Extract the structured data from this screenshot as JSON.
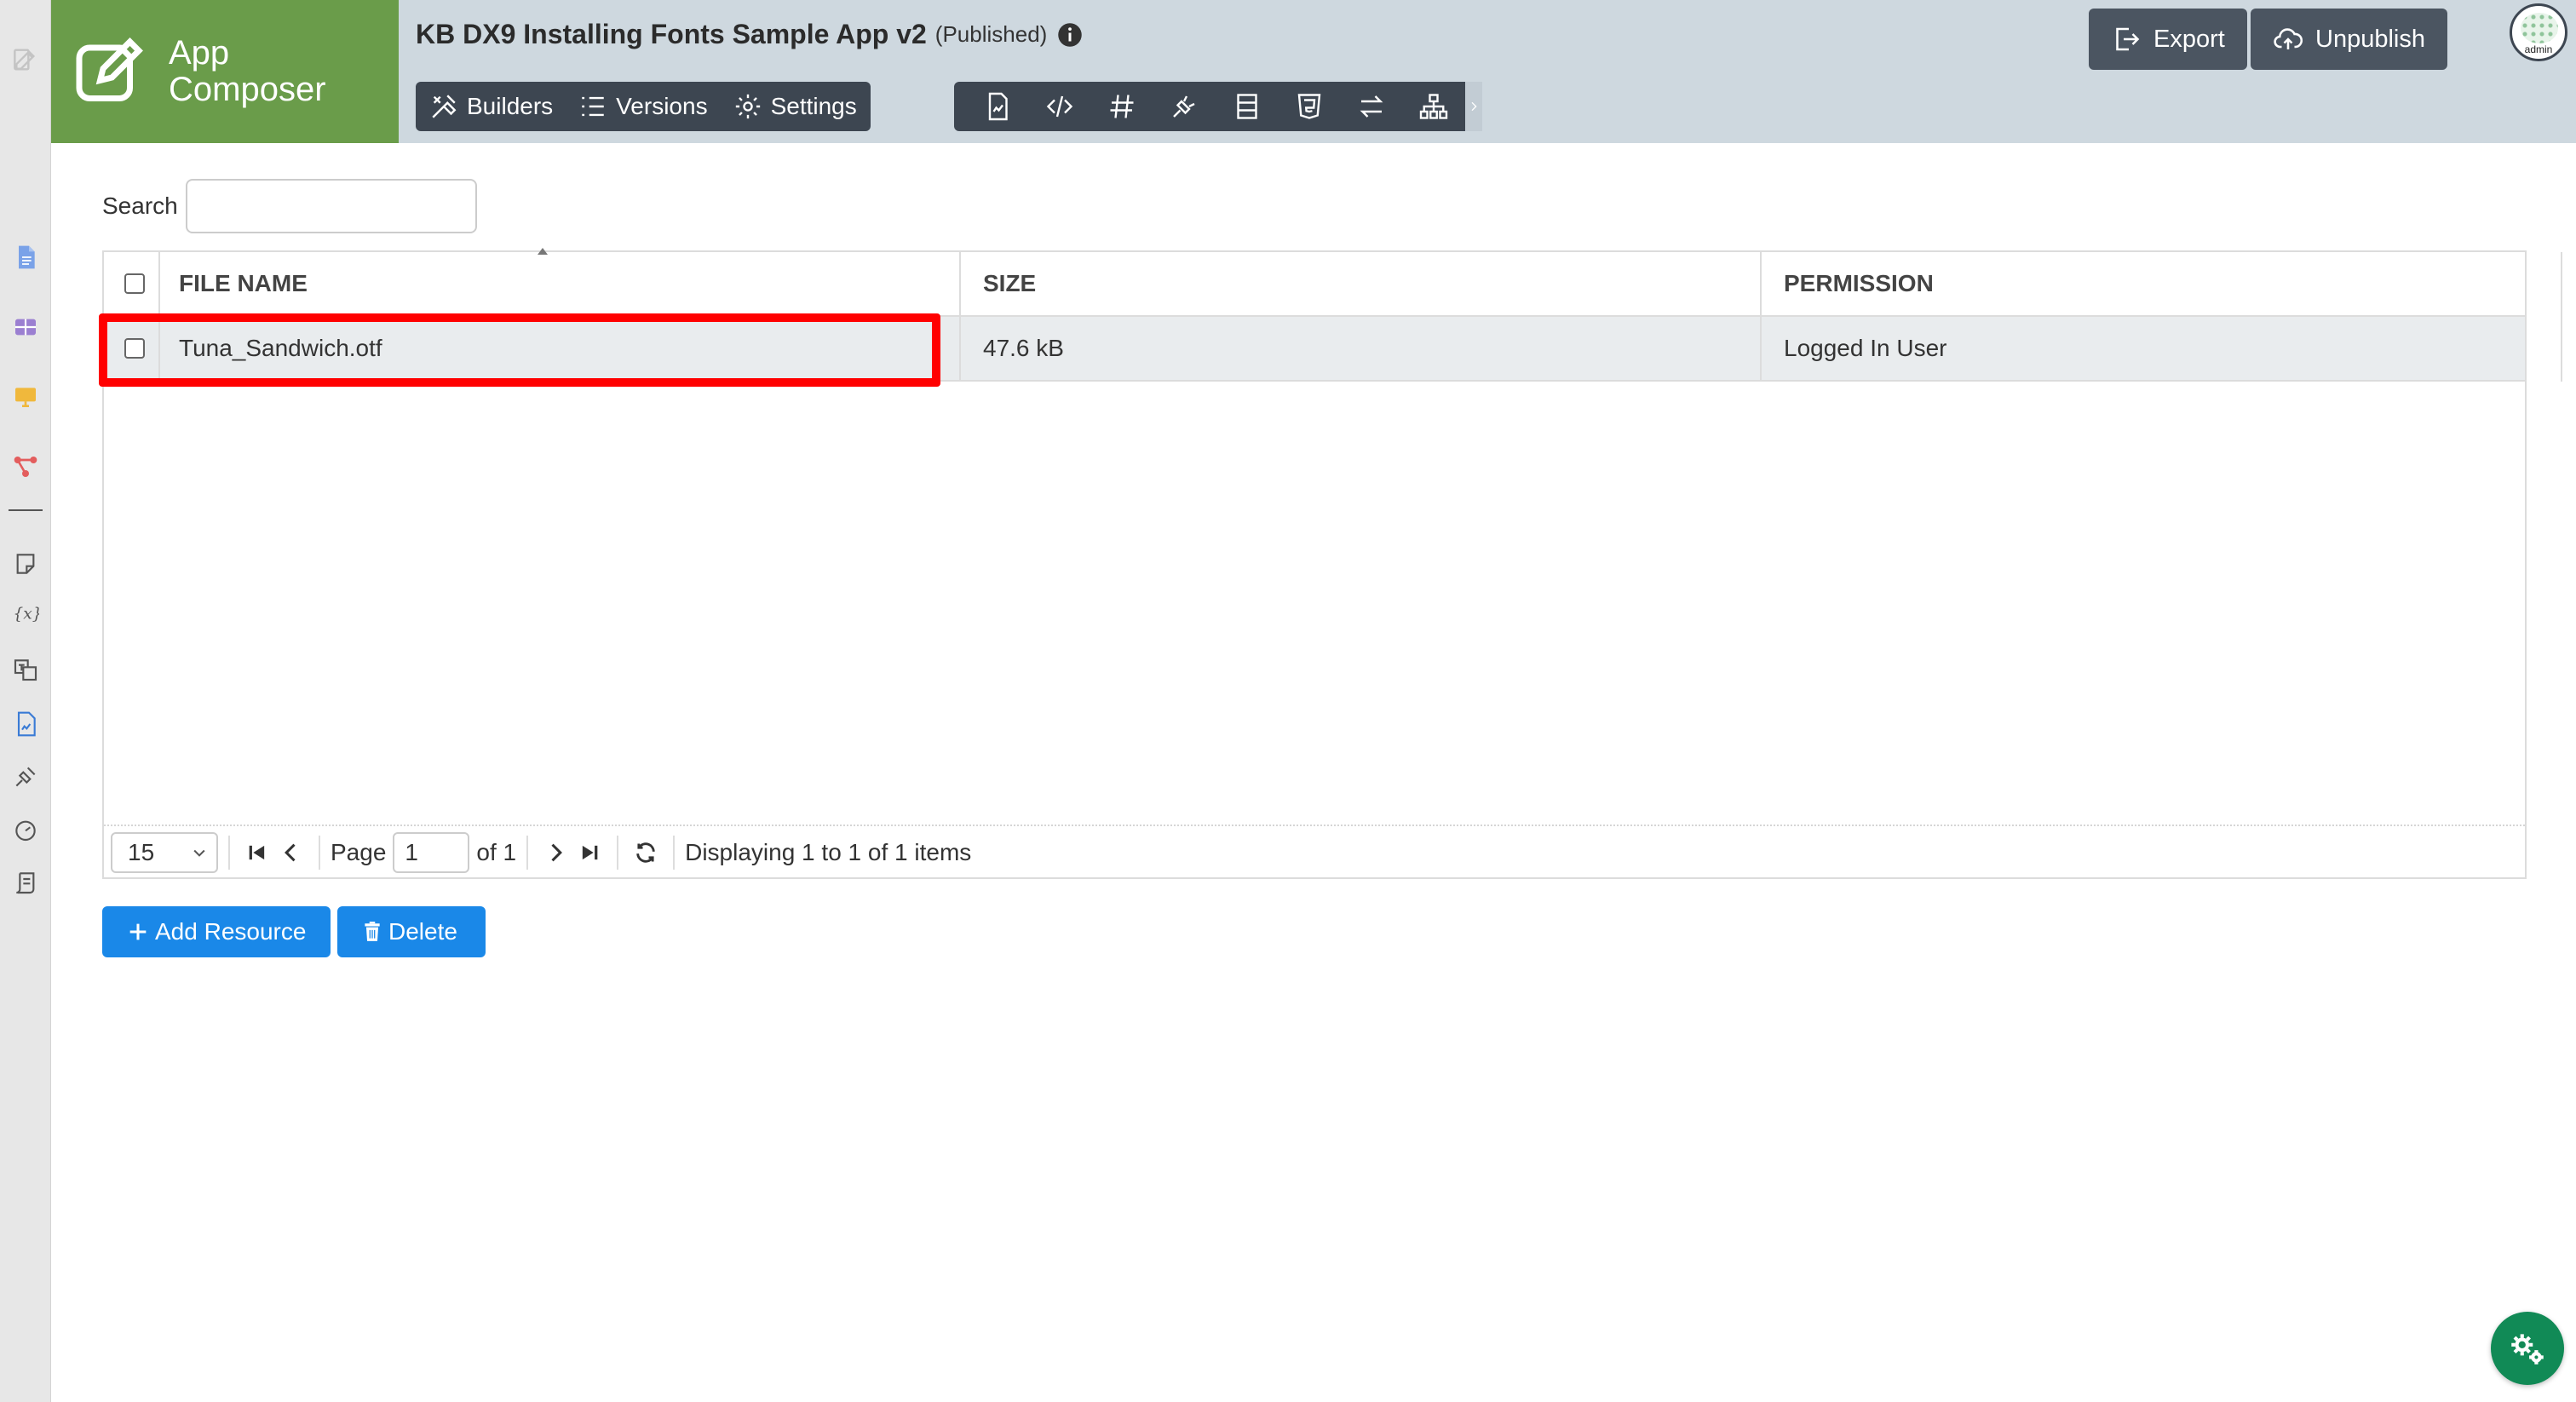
{
  "header": {
    "logo_line1": "App",
    "logo_line2": "Composer",
    "app_title": "KB DX9 Installing Fonts Sample App v2",
    "app_status": "(Published)",
    "tabs": [
      {
        "label": "Builders",
        "icon": "builders-icon"
      },
      {
        "label": "Versions",
        "icon": "list-icon"
      },
      {
        "label": "Settings",
        "icon": "gear-icon"
      }
    ],
    "toolbar_icons": [
      "pages-icon",
      "code-icon",
      "hash-icon",
      "plug-icon",
      "form-icon",
      "html5-icon",
      "sync-icon",
      "sitemap-icon"
    ],
    "export_label": "Export",
    "unpublish_label": "Unpublish",
    "avatar_label": "admin"
  },
  "search": {
    "label": "Search",
    "value": "",
    "placeholder": ""
  },
  "grid": {
    "columns": [
      "FILE NAME",
      "SIZE",
      "PERMISSION"
    ],
    "rows": [
      {
        "file_name": "Tuna_Sandwich.otf",
        "size": "47.6 kB",
        "permission": "Logged In User",
        "highlighted": true
      }
    ]
  },
  "pager": {
    "page_size": "15",
    "page_label": "Page",
    "page_value": "1",
    "of_label": "of 1",
    "display_text": "Displaying 1 to 1 of 1 items"
  },
  "actions": {
    "add_label": "Add Resource",
    "delete_label": "Delete"
  },
  "colors": {
    "logo_bg": "#6a9c4a",
    "header_bg": "#ced8df",
    "dark_bar": "#3d4651",
    "primary_button": "#1a88e8",
    "highlight": "#ff0000",
    "fab": "#118a56"
  }
}
